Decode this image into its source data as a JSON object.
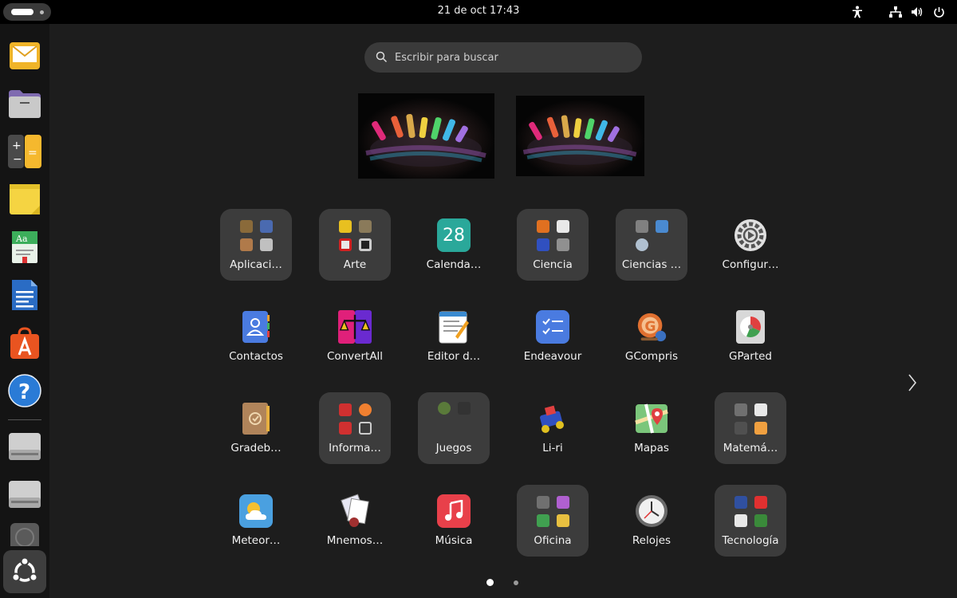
{
  "topbar": {
    "clock": "21 de oct  17:43",
    "tray_icons": [
      "accessibility-icon",
      "network-icon",
      "volume-icon",
      "power-icon"
    ]
  },
  "dock": {
    "items": [
      {
        "name": "mail-app",
        "icon": "mail-icon"
      },
      {
        "name": "files-app",
        "icon": "folder-icon"
      },
      {
        "name": "calculator-app",
        "icon": "calculator-icon"
      },
      {
        "name": "notes-app",
        "icon": "sticky-notes-icon"
      },
      {
        "name": "dictionary-app",
        "icon": "dictionary-icon"
      },
      {
        "name": "writer-app",
        "icon": "writer-icon"
      },
      {
        "name": "app-center",
        "icon": "app-store-icon"
      },
      {
        "name": "help-app",
        "icon": "help-icon"
      },
      {
        "name": "drive-1",
        "icon": "drive-icon"
      },
      {
        "name": "drive-2",
        "icon": "drive-icon"
      },
      {
        "name": "disk-app",
        "icon": "disk-icon"
      },
      {
        "name": "show-apps",
        "icon": "ubuntu-logo-icon"
      }
    ]
  },
  "search": {
    "placeholder": "Escribir para buscar"
  },
  "apps": [
    {
      "label": "Aplicaci…",
      "folder": true
    },
    {
      "label": "Arte",
      "folder": true
    },
    {
      "label": "Calenda…",
      "folder": false,
      "icon_text": "28"
    },
    {
      "label": "Ciencia",
      "folder": true
    },
    {
      "label": "Ciencias …",
      "folder": true
    },
    {
      "label": "Configur…",
      "folder": false
    },
    {
      "label": "Contactos",
      "folder": false
    },
    {
      "label": "ConvertAll",
      "folder": false
    },
    {
      "label": "Editor d…",
      "folder": false
    },
    {
      "label": "Endeavour",
      "folder": false
    },
    {
      "label": "GCompris",
      "folder": false
    },
    {
      "label": "GParted",
      "folder": false
    },
    {
      "label": "Gradeb…",
      "folder": false
    },
    {
      "label": "Informa…",
      "folder": true
    },
    {
      "label": "Juegos",
      "folder": true
    },
    {
      "label": "Li-ri",
      "folder": false
    },
    {
      "label": "Mapas",
      "folder": false
    },
    {
      "label": "Matemá…",
      "folder": true
    },
    {
      "label": "Meteor…",
      "folder": false
    },
    {
      "label": "Mnemos…",
      "folder": false
    },
    {
      "label": "Música",
      "folder": false
    },
    {
      "label": "Oficina",
      "folder": true
    },
    {
      "label": "Relojes",
      "folder": false
    },
    {
      "label": "Tecnología",
      "folder": true
    }
  ],
  "pagination": {
    "pages": 2,
    "current": 1
  }
}
